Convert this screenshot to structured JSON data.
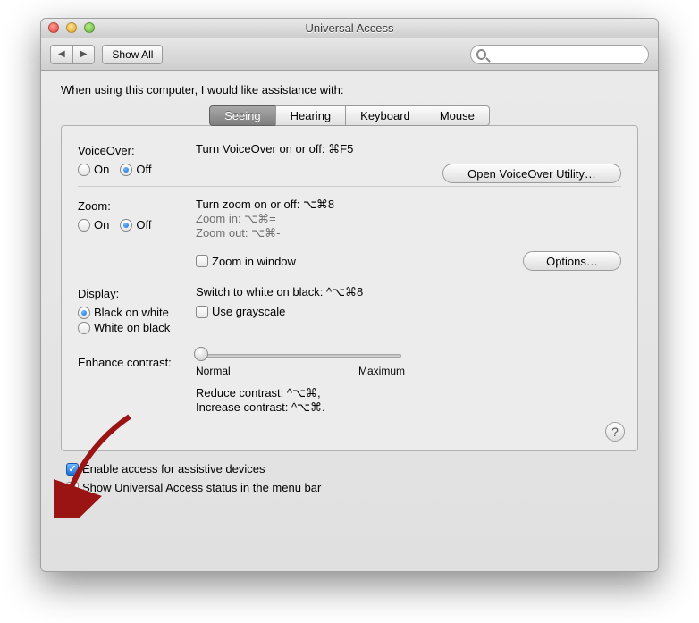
{
  "window": {
    "title": "Universal Access"
  },
  "toolbar": {
    "show_all_label": "Show All",
    "search_placeholder": ""
  },
  "intro": "When using this computer, I would like assistance with:",
  "tabs": [
    {
      "label": "Seeing",
      "active": true
    },
    {
      "label": "Hearing",
      "active": false
    },
    {
      "label": "Keyboard",
      "active": false
    },
    {
      "label": "Mouse",
      "active": false
    }
  ],
  "voiceover": {
    "heading": "VoiceOver:",
    "hint": "Turn VoiceOver on or off: ⌘F5",
    "on_label": "On",
    "off_label": "Off",
    "selected": "Off",
    "utility_button": "Open VoiceOver Utility…"
  },
  "zoom": {
    "heading": "Zoom:",
    "hint1": "Turn zoom on or off: ⌥⌘8",
    "hint2": "Zoom in: ⌥⌘=",
    "hint3": "Zoom out: ⌥⌘-",
    "on_label": "On",
    "off_label": "Off",
    "selected": "Off",
    "zoom_window_label": "Zoom in window",
    "zoom_window_checked": false,
    "options_button": "Options…"
  },
  "display": {
    "heading": "Display:",
    "hint": "Switch to white on black: ^⌥⌘8",
    "black_on_white": "Black on white",
    "white_on_black": "White on black",
    "selected": "Black on white",
    "grayscale_label": "Use grayscale",
    "grayscale_checked": false,
    "contrast_label": "Enhance contrast:",
    "slider_min": "Normal",
    "slider_max": "Maximum",
    "reduce_hint": "Reduce contrast: ^⌥⌘,",
    "increase_hint": "Increase contrast: ^⌥⌘."
  },
  "help_label": "?",
  "footer": {
    "assistive_label": "Enable access for assistive devices",
    "assistive_checked": true,
    "menubar_label": "Show Universal Access status in the menu bar",
    "menubar_checked": false
  }
}
